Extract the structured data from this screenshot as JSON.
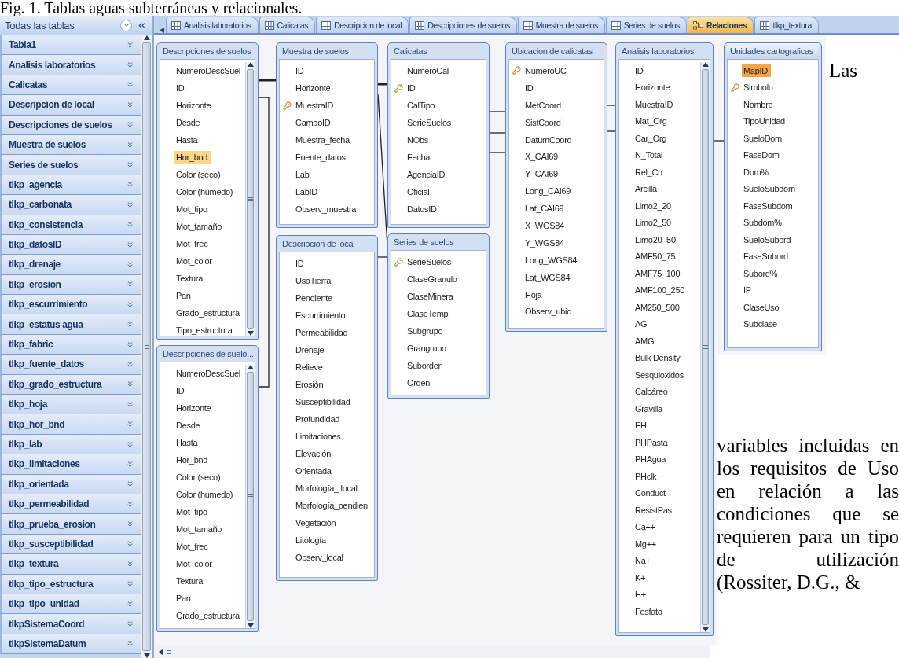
{
  "caption": "Fig. 1. Tablas aguas subterráneas y relacionales.",
  "navigation_pane": {
    "title": "Todas las tablas",
    "items": [
      {
        "label": "Tabla1"
      },
      {
        "label": "Analisis laboratorios"
      },
      {
        "label": "Calicatas"
      },
      {
        "label": "Descripcion de local"
      },
      {
        "label": "Descripciones de suelos"
      },
      {
        "label": "Muestra de suelos"
      },
      {
        "label": "Series de suelos"
      },
      {
        "label": "tlkp_agencia"
      },
      {
        "label": "tlkp_carbonata"
      },
      {
        "label": "tlkp_consistencia"
      },
      {
        "label": "tlkp_datosID"
      },
      {
        "label": "tlkp_drenaje"
      },
      {
        "label": "tlkp_erosion"
      },
      {
        "label": "tlkp_escurrimiento"
      },
      {
        "label": "tlkp_estatus agua"
      },
      {
        "label": "tlkp_fabric"
      },
      {
        "label": "tlkp_fuente_datos"
      },
      {
        "label": "tlkp_grado_estructura"
      },
      {
        "label": "tlkp_hoja"
      },
      {
        "label": "tlkp_hor_bnd"
      },
      {
        "label": "tlkp_lab"
      },
      {
        "label": "tlkp_limitaciones"
      },
      {
        "label": "tlkp_orientada"
      },
      {
        "label": "tlkp_permeabilidad"
      },
      {
        "label": "tlkp_prueba_erosion"
      },
      {
        "label": "tlkp_susceptibilidad"
      },
      {
        "label": "tlkp_textura"
      },
      {
        "label": "tlkp_tipo_estructura"
      },
      {
        "label": "tlkp_tipo_unidad"
      },
      {
        "label": "tlkpSistemaCoord"
      },
      {
        "label": "tlkpSistemaDatum"
      }
    ]
  },
  "tabs": [
    {
      "label": "Analisis laboratorios",
      "kind": "table",
      "selected": false
    },
    {
      "label": "Calicatas",
      "kind": "table",
      "selected": false
    },
    {
      "label": "Descripcion de local",
      "kind": "table",
      "selected": false
    },
    {
      "label": "Descripciones de suelos",
      "kind": "table",
      "selected": false
    },
    {
      "label": "Muestra de suelos",
      "kind": "table",
      "selected": false
    },
    {
      "label": "Series de suelos",
      "kind": "table",
      "selected": false
    },
    {
      "label": "Relaciones",
      "kind": "relationships",
      "selected": true
    },
    {
      "label": "tlkp_textura",
      "kind": "table",
      "selected": false
    }
  ],
  "tables": [
    {
      "title": "Descripciones de suelos",
      "kind": "scrollable",
      "active": false,
      "fields": [
        {
          "name": "NumeroDescSuel",
          "key": false,
          "selected": false
        },
        {
          "name": "ID",
          "key": false,
          "selected": false
        },
        {
          "name": "Horizonte",
          "key": false,
          "selected": false
        },
        {
          "name": "Desde",
          "key": false,
          "selected": false
        },
        {
          "name": "Hasta",
          "key": false,
          "selected": false
        },
        {
          "name": "Hor_bnd",
          "key": false,
          "selected": true
        },
        {
          "name": "Color (seco)",
          "key": false,
          "selected": false
        },
        {
          "name": "Color (humedo)",
          "key": false,
          "selected": false
        },
        {
          "name": "Mot_tipo",
          "key": false,
          "selected": false
        },
        {
          "name": "Mot_tamaño",
          "key": false,
          "selected": false
        },
        {
          "name": "Mot_frec",
          "key": false,
          "selected": false
        },
        {
          "name": "Mot_color",
          "key": false,
          "selected": false
        },
        {
          "name": "Textura",
          "key": false,
          "selected": false
        },
        {
          "name": "Pan",
          "key": false,
          "selected": false
        },
        {
          "name": "Grado_estructura",
          "key": false,
          "selected": false
        },
        {
          "name": "Tipo_estructura",
          "key": false,
          "selected": false
        }
      ]
    },
    {
      "title": "Descripciones de suelo...",
      "kind": "scrollable",
      "active": false,
      "fields": [
        {
          "name": "NumeroDescSuel",
          "key": false,
          "selected": false
        },
        {
          "name": "ID",
          "key": false,
          "selected": false
        },
        {
          "name": "Horizonte",
          "key": false,
          "selected": false
        },
        {
          "name": "Desde",
          "key": false,
          "selected": false
        },
        {
          "name": "Hasta",
          "key": false,
          "selected": false
        },
        {
          "name": "Hor_bnd",
          "key": false,
          "selected": false
        },
        {
          "name": "Color (seco)",
          "key": false,
          "selected": false
        },
        {
          "name": "Color (humedo)",
          "key": false,
          "selected": false
        },
        {
          "name": "Mot_tipo",
          "key": false,
          "selected": false
        },
        {
          "name": "Mot_tamaño",
          "key": false,
          "selected": false
        },
        {
          "name": "Mot_frec",
          "key": false,
          "selected": false
        },
        {
          "name": "Mot_color",
          "key": false,
          "selected": false
        },
        {
          "name": "Textura",
          "key": false,
          "selected": false
        },
        {
          "name": "Pan",
          "key": false,
          "selected": false
        },
        {
          "name": "Grado_estructura",
          "key": false,
          "selected": false
        }
      ]
    },
    {
      "title": "Muestra de suelos",
      "kind": "plain",
      "active": false,
      "fields": [
        {
          "name": "ID",
          "key": false,
          "selected": false
        },
        {
          "name": "Horizonte",
          "key": false,
          "selected": false
        },
        {
          "name": "MuestraID",
          "key": true,
          "selected": false
        },
        {
          "name": "CampoID",
          "key": false,
          "selected": false
        },
        {
          "name": "Muestra_fecha",
          "key": false,
          "selected": false
        },
        {
          "name": "Fuente_datos",
          "key": false,
          "selected": false
        },
        {
          "name": "Lab",
          "key": false,
          "selected": false
        },
        {
          "name": "LabID",
          "key": false,
          "selected": false
        },
        {
          "name": "Observ_muestra",
          "key": false,
          "selected": false
        }
      ]
    },
    {
      "title": "Descripcion de local",
      "kind": "plain",
      "active": false,
      "fields": [
        {
          "name": "ID",
          "key": false,
          "selected": false
        },
        {
          "name": "UsoTierra",
          "key": false,
          "selected": false
        },
        {
          "name": "Pendiente",
          "key": false,
          "selected": false
        },
        {
          "name": "Escurrimiento",
          "key": false,
          "selected": false
        },
        {
          "name": "Permeabilidad",
          "key": false,
          "selected": false
        },
        {
          "name": "Drenaje",
          "key": false,
          "selected": false
        },
        {
          "name": "Relieve",
          "key": false,
          "selected": false
        },
        {
          "name": "Erosión",
          "key": false,
          "selected": false
        },
        {
          "name": "Susceptibilidad",
          "key": false,
          "selected": false
        },
        {
          "name": "Profundidad",
          "key": false,
          "selected": false
        },
        {
          "name": "Limitaciones",
          "key": false,
          "selected": false
        },
        {
          "name": "Elevación",
          "key": false,
          "selected": false
        },
        {
          "name": "Orientada",
          "key": false,
          "selected": false
        },
        {
          "name": "Morfología_ local",
          "key": false,
          "selected": false
        },
        {
          "name": "Morfología_pendien",
          "key": false,
          "selected": false
        },
        {
          "name": "Vegetación",
          "key": false,
          "selected": false
        },
        {
          "name": "Litología",
          "key": false,
          "selected": false
        },
        {
          "name": "Observ_local",
          "key": false,
          "selected": false
        }
      ]
    },
    {
      "title": "Calicatas",
      "kind": "plain",
      "active": false,
      "fields": [
        {
          "name": "NumeroCal",
          "key": false,
          "selected": false
        },
        {
          "name": "ID",
          "key": true,
          "selected": false
        },
        {
          "name": "CalTipo",
          "key": false,
          "selected": false
        },
        {
          "name": "SerieSuelos",
          "key": false,
          "selected": false
        },
        {
          "name": "NObs",
          "key": false,
          "selected": false
        },
        {
          "name": "Fecha",
          "key": false,
          "selected": false
        },
        {
          "name": "AgenciaID",
          "key": false,
          "selected": false
        },
        {
          "name": "Oficial",
          "key": false,
          "selected": false
        },
        {
          "name": "DatosID",
          "key": false,
          "selected": false
        }
      ]
    },
    {
      "title": "Series de suelos",
      "kind": "plain",
      "active": false,
      "fields": [
        {
          "name": "SerieSuelos",
          "key": true,
          "selected": false
        },
        {
          "name": "ClaseGranulo",
          "key": false,
          "selected": false
        },
        {
          "name": "ClaseMinera",
          "key": false,
          "selected": false
        },
        {
          "name": "ClaseTemp",
          "key": false,
          "selected": false
        },
        {
          "name": "Subgrupo",
          "key": false,
          "selected": false
        },
        {
          "name": "Grangrupo",
          "key": false,
          "selected": false
        },
        {
          "name": "Suborden",
          "key": false,
          "selected": false
        },
        {
          "name": "Orden",
          "key": false,
          "selected": false
        }
      ]
    },
    {
      "title": "Ubicacion de calicatas",
      "kind": "plain",
      "active": false,
      "fields": [
        {
          "name": "NumeroUC",
          "key": true,
          "selected": false
        },
        {
          "name": "ID",
          "key": false,
          "selected": false
        },
        {
          "name": "MetCoord",
          "key": false,
          "selected": false
        },
        {
          "name": "SistCoord",
          "key": false,
          "selected": false
        },
        {
          "name": "DatumCoord",
          "key": false,
          "selected": false
        },
        {
          "name": "X_CAI69",
          "key": false,
          "selected": false
        },
        {
          "name": "Y_CAI69",
          "key": false,
          "selected": false
        },
        {
          "name": "Long_CAI69",
          "key": false,
          "selected": false
        },
        {
          "name": "Lat_CAI69",
          "key": false,
          "selected": false
        },
        {
          "name": "X_WGS84",
          "key": false,
          "selected": false
        },
        {
          "name": "Y_WGS84",
          "key": false,
          "selected": false
        },
        {
          "name": "Long_WGS84",
          "key": false,
          "selected": false
        },
        {
          "name": "Lat_WGS84",
          "key": false,
          "selected": false
        },
        {
          "name": "Hoja",
          "key": false,
          "selected": false
        },
        {
          "name": "Observ_ubic",
          "key": false,
          "selected": false
        }
      ]
    },
    {
      "title": "Analisis laboratorios",
      "kind": "scrollable",
      "active": false,
      "fields": [
        {
          "name": "ID",
          "key": false,
          "selected": false
        },
        {
          "name": "Horizonte",
          "key": false,
          "selected": false
        },
        {
          "name": "MuestraID",
          "key": false,
          "selected": false
        },
        {
          "name": "Mat_Org",
          "key": false,
          "selected": false
        },
        {
          "name": "Car_Org",
          "key": false,
          "selected": false
        },
        {
          "name": "N_Total",
          "key": false,
          "selected": false
        },
        {
          "name": "Rel_Cn",
          "key": false,
          "selected": false
        },
        {
          "name": "Arcilla",
          "key": false,
          "selected": false
        },
        {
          "name": "Limo2_20",
          "key": false,
          "selected": false
        },
        {
          "name": "Limo2_50",
          "key": false,
          "selected": false
        },
        {
          "name": "Limo20_50",
          "key": false,
          "selected": false
        },
        {
          "name": "AMF50_75",
          "key": false,
          "selected": false
        },
        {
          "name": "AMF75_100",
          "key": false,
          "selected": false
        },
        {
          "name": "AMF100_250",
          "key": false,
          "selected": false
        },
        {
          "name": "AM250_500",
          "key": false,
          "selected": false
        },
        {
          "name": "AG",
          "key": false,
          "selected": false
        },
        {
          "name": "AMG",
          "key": false,
          "selected": false
        },
        {
          "name": "Bulk Density",
          "key": false,
          "selected": false
        },
        {
          "name": "Sesquioxidos",
          "key": false,
          "selected": false
        },
        {
          "name": "Calcáreo",
          "key": false,
          "selected": false
        },
        {
          "name": "Gravilla",
          "key": false,
          "selected": false
        },
        {
          "name": "EH",
          "key": false,
          "selected": false
        },
        {
          "name": "PHPasta",
          "key": false,
          "selected": false
        },
        {
          "name": "PHAgua",
          "key": false,
          "selected": false
        },
        {
          "name": "PHclk",
          "key": false,
          "selected": false
        },
        {
          "name": "Conduct",
          "key": false,
          "selected": false
        },
        {
          "name": "ResistPas",
          "key": false,
          "selected": false
        },
        {
          "name": "Ca++",
          "key": false,
          "selected": false
        },
        {
          "name": "Mg++",
          "key": false,
          "selected": false
        },
        {
          "name": "Na+",
          "key": false,
          "selected": false
        },
        {
          "name": "K+",
          "key": false,
          "selected": false
        },
        {
          "name": "H+",
          "key": false,
          "selected": false
        },
        {
          "name": "Fosfato",
          "key": false,
          "selected": false
        }
      ]
    },
    {
      "title": "Unidades cartograficas",
      "kind": "plain",
      "active": true,
      "fields": [
        {
          "name": "MapID",
          "key": false,
          "selected": true
        },
        {
          "name": "Simbolo",
          "key": true,
          "selected": false
        },
        {
          "name": "Nombre",
          "key": false,
          "selected": false
        },
        {
          "name": "TipoUnidad",
          "key": false,
          "selected": false
        },
        {
          "name": "SueloDom",
          "key": false,
          "selected": false
        },
        {
          "name": "FaseDom",
          "key": false,
          "selected": false
        },
        {
          "name": "Dom%",
          "key": false,
          "selected": false
        },
        {
          "name": "SueloSubdom",
          "key": false,
          "selected": false
        },
        {
          "name": "FaseSubdom",
          "key": false,
          "selected": false
        },
        {
          "name": "Subdom%",
          "key": false,
          "selected": false
        },
        {
          "name": "SueloSubord",
          "key": false,
          "selected": false
        },
        {
          "name": "FaseSubord",
          "key": false,
          "selected": false
        },
        {
          "name": "Subord%",
          "key": false,
          "selected": false
        },
        {
          "name": "IP",
          "key": false,
          "selected": false
        },
        {
          "name": "ClaseUso",
          "key": false,
          "selected": false
        },
        {
          "name": "Subclase",
          "key": false,
          "selected": false
        }
      ]
    }
  ],
  "document_text": {
    "lead": "Las",
    "paragraph": "variables incluidas en los requisitos de Uso en relación a las condiciones que se requieren para un tipo de utilización (Rossiter, D.G., &"
  }
}
